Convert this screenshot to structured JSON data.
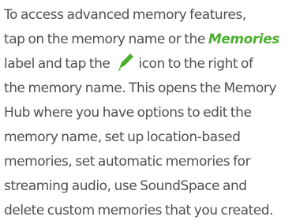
{
  "paragraph": {
    "l1": "To access advanced memory features,",
    "l2_pre": "tap on the memory name or the ",
    "l2_emph": "Memories",
    "l3_pre": "label and tap the ",
    "l3_post": "icon to the right of",
    "l4": "the memory name. This opens the Memory",
    "l5": "Hub where you have options to edit the",
    "l6": "memory name, set up location-based",
    "l7": "memories, set automatic memories for",
    "l8": "streaming audio, use SoundSpace and",
    "l9": "delete custom memories that you created."
  },
  "icons": {
    "edit": "pencil-icon"
  },
  "colors": {
    "text": "#505050",
    "accent": "#4caf2f"
  }
}
